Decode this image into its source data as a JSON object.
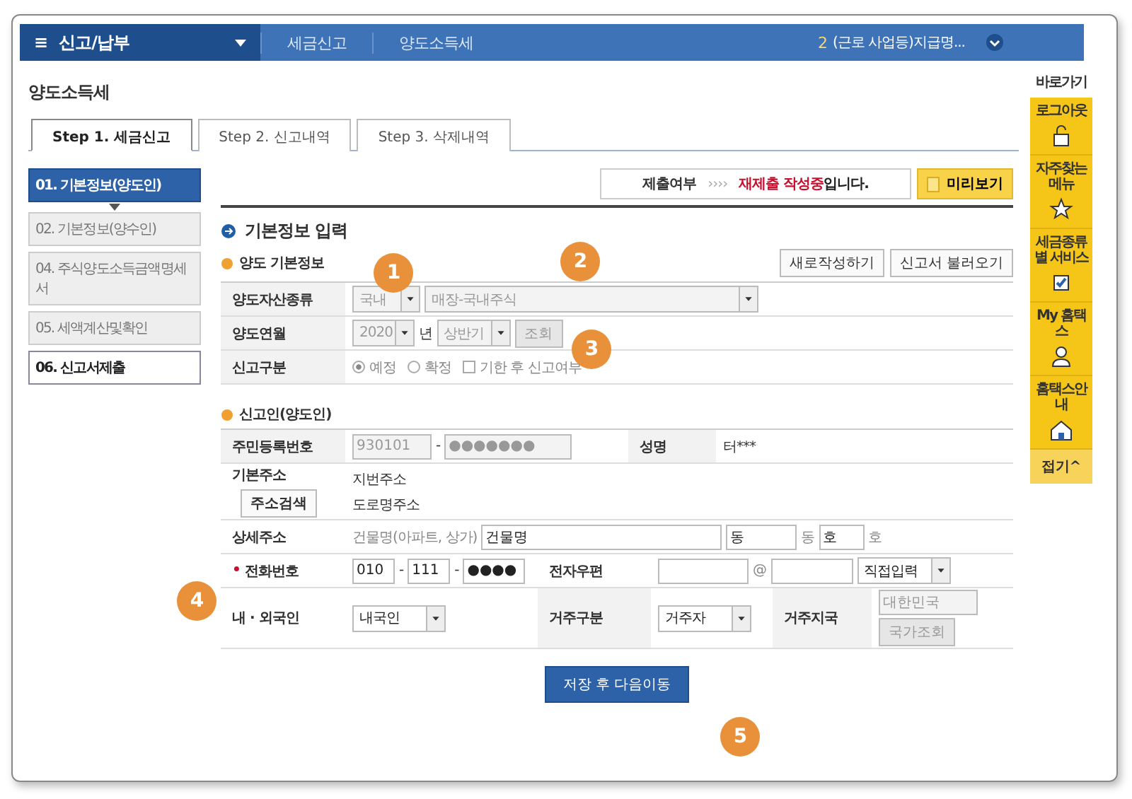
{
  "nav": {
    "menu_icon": "≡",
    "title": "신고/납부",
    "crumbs": [
      "세금신고",
      "양도소득세"
    ],
    "user_count": "2",
    "user": "(근로 사업등)지급명..."
  },
  "page_title": "양도소득세",
  "tabs": [
    {
      "label": "Step 1. 세금신고",
      "selected": true
    },
    {
      "label": "Step 2. 신고내역",
      "selected": false
    },
    {
      "label": "Step 3. 삭제내역",
      "selected": false
    }
  ],
  "steps": [
    {
      "label": "01. 기본정보(양도인)",
      "selected": true,
      "disabled": false
    },
    {
      "label": "02. 기본정보(양수인)",
      "selected": false,
      "disabled": true
    },
    {
      "label": "04. 주식양도소득금액명세서",
      "selected": false,
      "disabled": true
    },
    {
      "label": "05. 세액계산및확인",
      "selected": false,
      "disabled": true
    },
    {
      "label": "06. 신고서제출",
      "selected": false,
      "disabled": false
    }
  ],
  "status": {
    "label": "제출여부",
    "arrows": "››››",
    "parts": [
      {
        "text": "재제출 작성중",
        "highlight": true
      },
      {
        "text": "입니다.",
        "highlight": false
      }
    ],
    "preview": "미리보기"
  },
  "section_title": "기본정보 입력",
  "transfer": {
    "title": "양도 기본정보",
    "buttons": [
      "새로작성하기",
      "신고서 불러오기"
    ],
    "asset_label": "양도자산종류",
    "asset_type": {
      "value": "국내",
      "disabled": true
    },
    "asset_kind": {
      "value": "매장-국내주식",
      "disabled": true
    },
    "period_label": "양도연월",
    "year": {
      "value": "2020",
      "disabled": true
    },
    "year_unit": "년",
    "half": {
      "value": "상반기",
      "disabled": true
    },
    "lookup": {
      "label": "조회",
      "disabled": true
    },
    "type_label": "신고구분",
    "radios": [
      {
        "label": "예정",
        "selected": true
      },
      {
        "label": "확정",
        "selected": false
      }
    ],
    "late": {
      "label": "기한 후 신고여부",
      "checked": false
    }
  },
  "reporter": {
    "title": "신고인(양도인)",
    "id_label": "주민등록번호",
    "id_front": {
      "value": "930101",
      "disabled": true
    },
    "id_separator": "-",
    "id_back": {
      "value": "●●●●●●●",
      "disabled": true
    },
    "name_label": "성명",
    "name": "터***",
    "address_label": "기본주소",
    "address_button": "주소검색",
    "address_lines": [
      "지번주소",
      "도로명주소"
    ],
    "detail_label": "상세주소",
    "building_label": "건물명(아파트, 상가)",
    "building": "건물명",
    "dong": "동",
    "dong_unit": "동",
    "ho": "호",
    "ho_unit": "호",
    "phone_label": "전화번호",
    "required_mark": "•",
    "phone_separator": "-",
    "phone": [
      "010",
      "111",
      "●●●●"
    ],
    "email_label": "전자우편",
    "email_at": "@",
    "email_domain": "직접입력",
    "nation_label": "내 · 외국인",
    "nation": "내국인",
    "residence_label": "거주구분",
    "residence": "거주자",
    "country_label": "거주지국",
    "country": {
      "value": "대한민국",
      "disabled": true
    },
    "country_button": {
      "label": "국가조회",
      "disabled": true
    }
  },
  "save_button": "저장 후 다음이동",
  "markers": [
    "1",
    "2",
    "3",
    "4",
    "5"
  ],
  "quick": {
    "title": "바로가기",
    "items": [
      {
        "label": "로그아웃",
        "kind": "lock"
      },
      {
        "label": "자주찾는 메뉴",
        "kind": "star"
      },
      {
        "label": "세금종류별 서비스",
        "kind": "check"
      },
      {
        "label": "My 홈택스",
        "kind": "person"
      },
      {
        "label": "홈택스안내",
        "kind": "house"
      }
    ],
    "fold": "접기^"
  }
}
